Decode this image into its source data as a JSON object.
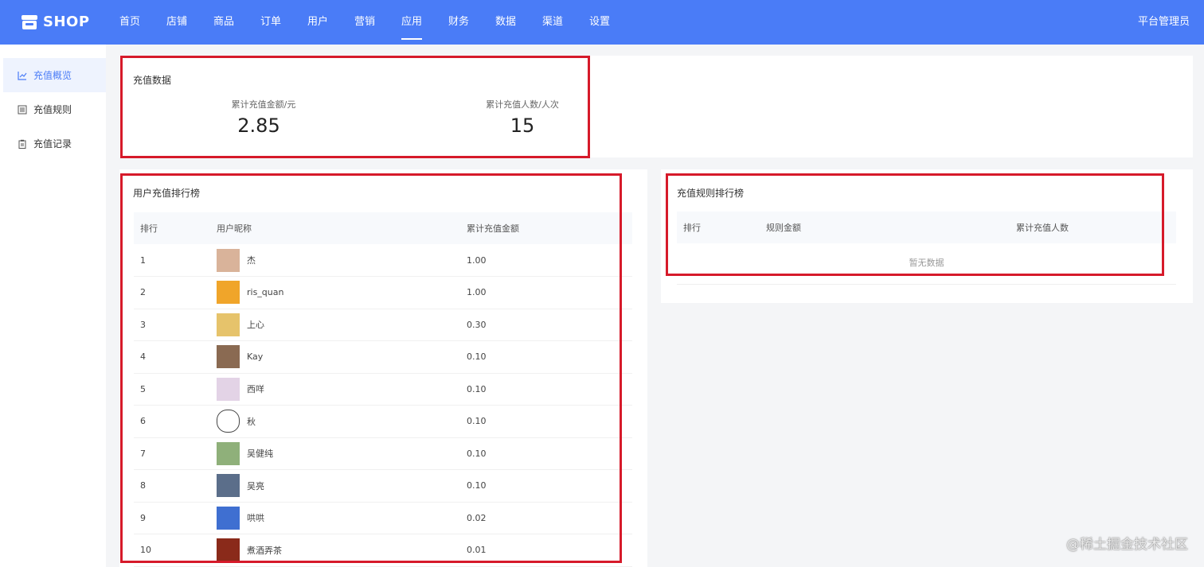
{
  "brand": {
    "name": "SHOP"
  },
  "nav": {
    "items": [
      "首页",
      "店铺",
      "商品",
      "订单",
      "用户",
      "营销",
      "应用",
      "财务",
      "数据",
      "渠道",
      "设置"
    ],
    "active": "应用",
    "admin": "平台管理员"
  },
  "sidebar": {
    "items": [
      {
        "label": "充值概览",
        "icon": "chart-line-icon",
        "active": true
      },
      {
        "label": "充值规则",
        "icon": "list-icon",
        "active": false
      },
      {
        "label": "充值记录",
        "icon": "clipboard-icon",
        "active": false
      }
    ]
  },
  "overview": {
    "title": "充值数据",
    "total_amount_label": "累计充值金额/元",
    "total_amount": "2.85",
    "total_users_label": "累计充值人数/人次",
    "total_users": "15"
  },
  "user_rank": {
    "title": "用户充值排行榜",
    "columns": [
      "排行",
      "用户昵称",
      "累计充值金额"
    ],
    "rows": [
      {
        "rank": "1",
        "name": "杰",
        "amount": "1.00",
        "avatar_color": "#d9b39a"
      },
      {
        "rank": "2",
        "name": "ris_quan",
        "amount": "1.00",
        "avatar_color": "#f0a52a"
      },
      {
        "rank": "3",
        "name": "上心",
        "amount": "0.30",
        "avatar_color": "#e6c36b"
      },
      {
        "rank": "4",
        "name": "Kay",
        "amount": "0.10",
        "avatar_color": "#8a6a52"
      },
      {
        "rank": "5",
        "name": "西咩",
        "amount": "0.10",
        "avatar_color": "#e3d3e6"
      },
      {
        "rank": "6",
        "name": "秋",
        "amount": "0.10",
        "avatar_color": "#ffffff"
      },
      {
        "rank": "7",
        "name": "吴健纯",
        "amount": "0.10",
        "avatar_color": "#8fb07a"
      },
      {
        "rank": "8",
        "name": "吴亮",
        "amount": "0.10",
        "avatar_color": "#5b6e8a"
      },
      {
        "rank": "9",
        "name": "哄哄",
        "amount": "0.02",
        "avatar_color": "#3f6fd1"
      },
      {
        "rank": "10",
        "name": "煮酒弄茶",
        "amount": "0.01",
        "avatar_color": "#8a2a1a"
      }
    ]
  },
  "rule_rank": {
    "title": "充值规则排行榜",
    "columns": [
      "排行",
      "规则金额",
      "累计充值人数"
    ],
    "empty_text": "暂无数据"
  },
  "watermark": "@稀土掘金技术社区",
  "colors": {
    "primary": "#4a7cf7",
    "highlight_border": "#d61a2a"
  }
}
